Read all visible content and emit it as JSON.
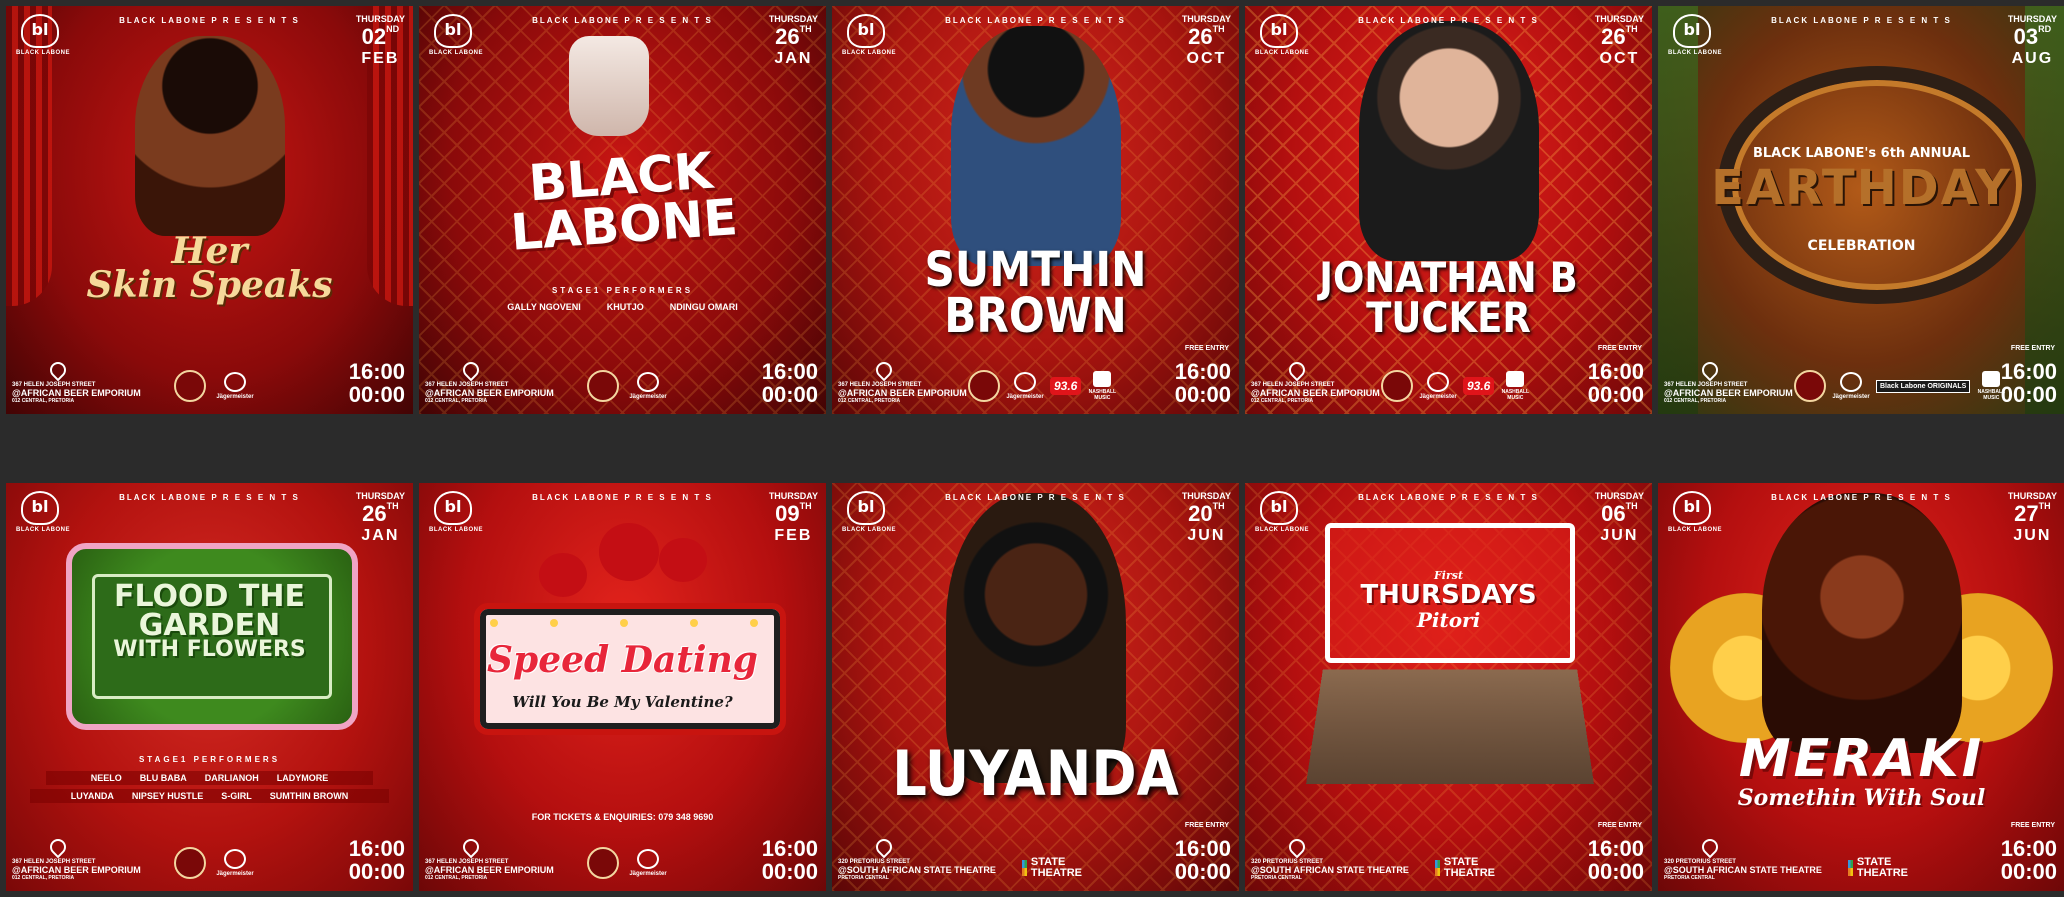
{
  "common": {
    "logo_text": "BLACK LABONE",
    "logo_mark": "bl",
    "presents": "BLACK LABONE P R E S E N T S",
    "start_time": "16:00",
    "end_time": "00:00",
    "free_entry": "FREE ENTRY",
    "dow": "THURSDAY",
    "jager": "Jägermeister",
    "radio": "93.6",
    "nb": "NASHBALL MUSIC",
    "state_theatre": "STATE THEATRE",
    "originals": "Black Labone ORIGINALS"
  },
  "venues": {
    "beer": {
      "street": "367 HELEN JOSEPH STREET",
      "name": "@AFRICAN BEER EMPORIUM",
      "area": "012 CENTRAL, PRETORIA"
    },
    "theatre": {
      "street": "320 PRETORIUS STREET",
      "name": "@SOUTH AFRICAN STATE THEATRE",
      "area": "PRETORIA CENTRAL"
    }
  },
  "posters": [
    {
      "day": "02",
      "suffix": "ND",
      "month": "FEB",
      "title_line1": "Her",
      "title_line2": "Skin Speaks"
    },
    {
      "day": "26",
      "suffix": "TH",
      "month": "JAN",
      "title_line1": "BLACK",
      "title_line2": "LABONE",
      "performers_heading": "STAGE1 PERFORMERS",
      "performers": [
        "GALLY NGOVENI",
        "KHUTJO",
        "NDINGU OMARI"
      ]
    },
    {
      "day": "26",
      "suffix": "TH",
      "month": "OCT",
      "title_line1": "SUMTHIN",
      "title_line2": "BROWN"
    },
    {
      "day": "26",
      "suffix": "TH",
      "month": "OCT",
      "title_line1": "JONATHAN B",
      "title_line2": "TUCKER"
    },
    {
      "day": "03",
      "suffix": "RD",
      "month": "AUG",
      "annual": "BLACK LABONE's 6th ANNUAL",
      "title": "EARTHDAY",
      "subtitle": "CELEBRATION"
    },
    {
      "day": "26",
      "suffix": "TH",
      "month": "JAN",
      "title_line1": "FLOOD THE",
      "title_line2": "GARDEN",
      "title_line3": "WITH FLOWERS",
      "performers_heading": "STAGE1 PERFORMERS",
      "lineup_row1": [
        "NEELO",
        "BLU BABA",
        "DARLIANOH",
        "LADYMORE"
      ],
      "lineup_row2": [
        "LUYANDA",
        "NIPSEY HUSTLE",
        "S-GIRL",
        "SUMTHIN BROWN"
      ]
    },
    {
      "day": "09",
      "suffix": "TH",
      "month": "FEB",
      "title": "Speed Dating",
      "subtitle": "Will You Be My Valentine?",
      "tickets": "FOR TICKETS & ENQUIRIES: 079 348 9690"
    },
    {
      "day": "20",
      "suffix": "TH",
      "month": "JUN",
      "title": "LUYANDA"
    },
    {
      "day": "06",
      "suffix": "TH",
      "month": "JUN",
      "title_small": "First",
      "title": "THURSDAYS",
      "title_script": "Pitori"
    },
    {
      "day": "27",
      "suffix": "TH",
      "month": "JUN",
      "title": "MERAKI",
      "subtitle": "Somethin With Soul"
    }
  ]
}
